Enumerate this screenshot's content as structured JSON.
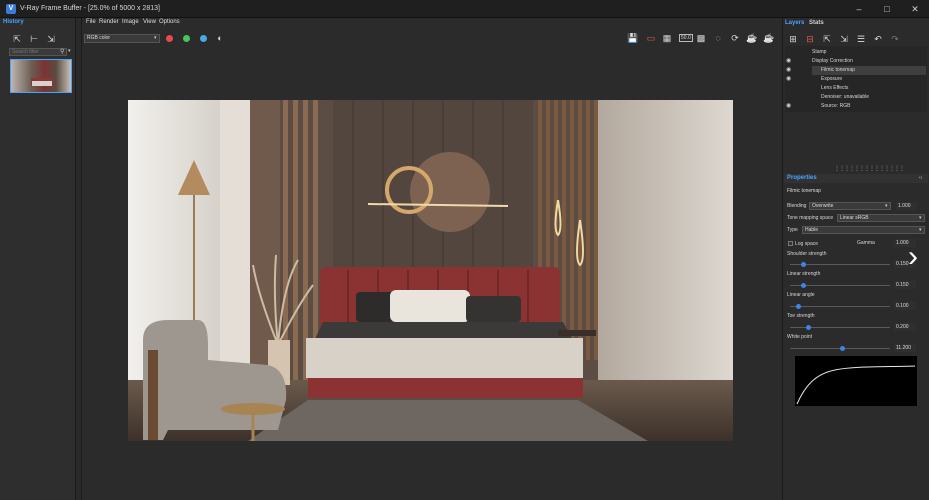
{
  "window": {
    "icon": "vray-icon",
    "title": "V-Ray Frame Buffer - [25.0% of 5000 x 2813]",
    "controls": [
      "minimize-icon",
      "maximize-icon",
      "close-icon"
    ]
  },
  "history": {
    "tab_label": "History",
    "tools": [
      "save-history-icon",
      "compare-ab-icon",
      "load-history-icon"
    ],
    "filter_placeholder": "Search filter",
    "thumb_label": "bedroom render"
  },
  "menu": [
    "File",
    "Render",
    "Image",
    "View",
    "Options"
  ],
  "viewport_toolbar": {
    "channel": "RGB color",
    "channel_colors": {
      "red": "#e64b4b",
      "green": "#4bc45b",
      "blue": "#4ba8e6"
    },
    "mono_icon": "monochrome-icon",
    "right_icons": [
      "save-image-icon",
      "clear-image-icon",
      "region-render-icon",
      "zoom-level-icon",
      "track-mouse-icon",
      "interactive-render-icon",
      "render-icon",
      "stop-render-icon",
      "teapot-render-icon"
    ],
    "zoom_label": "50.0"
  },
  "layers": {
    "tabs": [
      "Layers",
      "Stats"
    ],
    "tools": [
      "add-layer-icon",
      "delete-layer-icon",
      "save-layers-icon",
      "load-layers-icon",
      "layer-list-icon",
      "undo-icon",
      "redo-icon"
    ],
    "items": [
      {
        "label": "Stamp",
        "visible": false,
        "indent": 0
      },
      {
        "label": "Display Correction",
        "visible": true,
        "indent": 0
      },
      {
        "label": "Filmic tonemap",
        "visible": true,
        "indent": 1,
        "selected": true
      },
      {
        "label": "Exposure",
        "visible": true,
        "indent": 1
      },
      {
        "label": "Lens Effects",
        "visible": false,
        "indent": 1
      },
      {
        "label": "Denoiser: unavailable",
        "visible": false,
        "indent": 1
      },
      {
        "label": "Source: RGB",
        "visible": true,
        "indent": 1
      }
    ]
  },
  "properties": {
    "title": "Properties",
    "subtitle": "Filmic tonemap",
    "blending_label": "Blending",
    "blending_value": "Overwrite",
    "blending_amount": "1.000",
    "tone_space_label": "Tone mapping space",
    "tone_space_value": "Linear sRGB",
    "type_label": "Type",
    "type_value": "Hable",
    "log_space_label": "Log space",
    "gamma_label": "Gamma",
    "gamma_value": "1.000",
    "shoulder_label": "Shoulder strength",
    "shoulder_value": "0.150",
    "shoulder_level": 0.13,
    "linear_strength_label": "Linear strength",
    "linear_strength_value": "0.150",
    "linear_strength_level": 0.13,
    "linear_angle_label": "Linear angle",
    "linear_angle_value": "0.100",
    "linear_angle_level": 0.08,
    "toe_label": "Toe strength",
    "toe_value": "0.200",
    "toe_level": 0.18,
    "white_point_label": "White point",
    "white_point_value": "11.200",
    "white_point_level": 0.52
  }
}
